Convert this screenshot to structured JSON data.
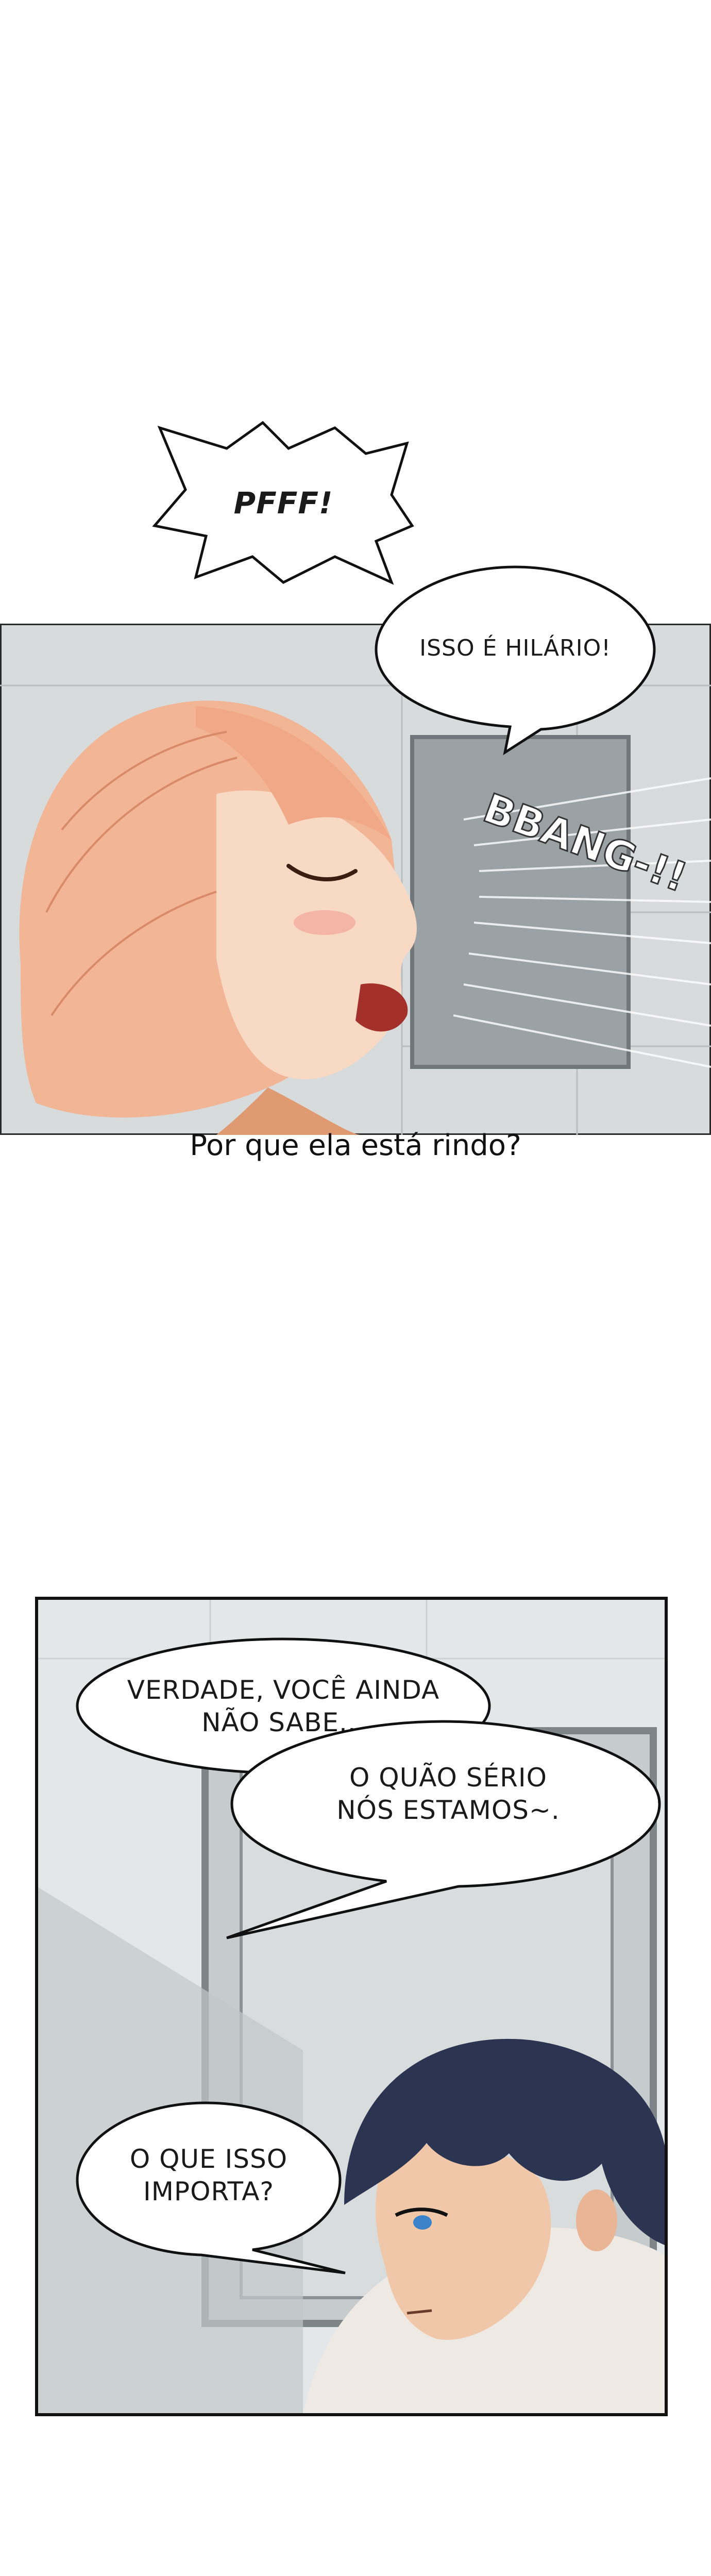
{
  "panel1": {
    "shout": "PFFF!",
    "speech": "ISSO É HILÁRIO!",
    "sfx": "BBANG-!!"
  },
  "caption": "Por que ela está rindo?",
  "panel2": {
    "speech1": "VERDADE, VOCÊ AINDA\nNÃO SABE...",
    "speech2": "O QUÃO SÉRIO\nNÓS ESTAMOS~.",
    "speech3": "O QUE ISSO\nIMPORTA?"
  },
  "colors": {
    "hair_peach": "#f2b595",
    "skin": "#f8d9c4",
    "wall_gray": "#c9cdd0",
    "door_gray": "#8a9296",
    "boy_hair": "#2b3552",
    "border": "#111111"
  }
}
